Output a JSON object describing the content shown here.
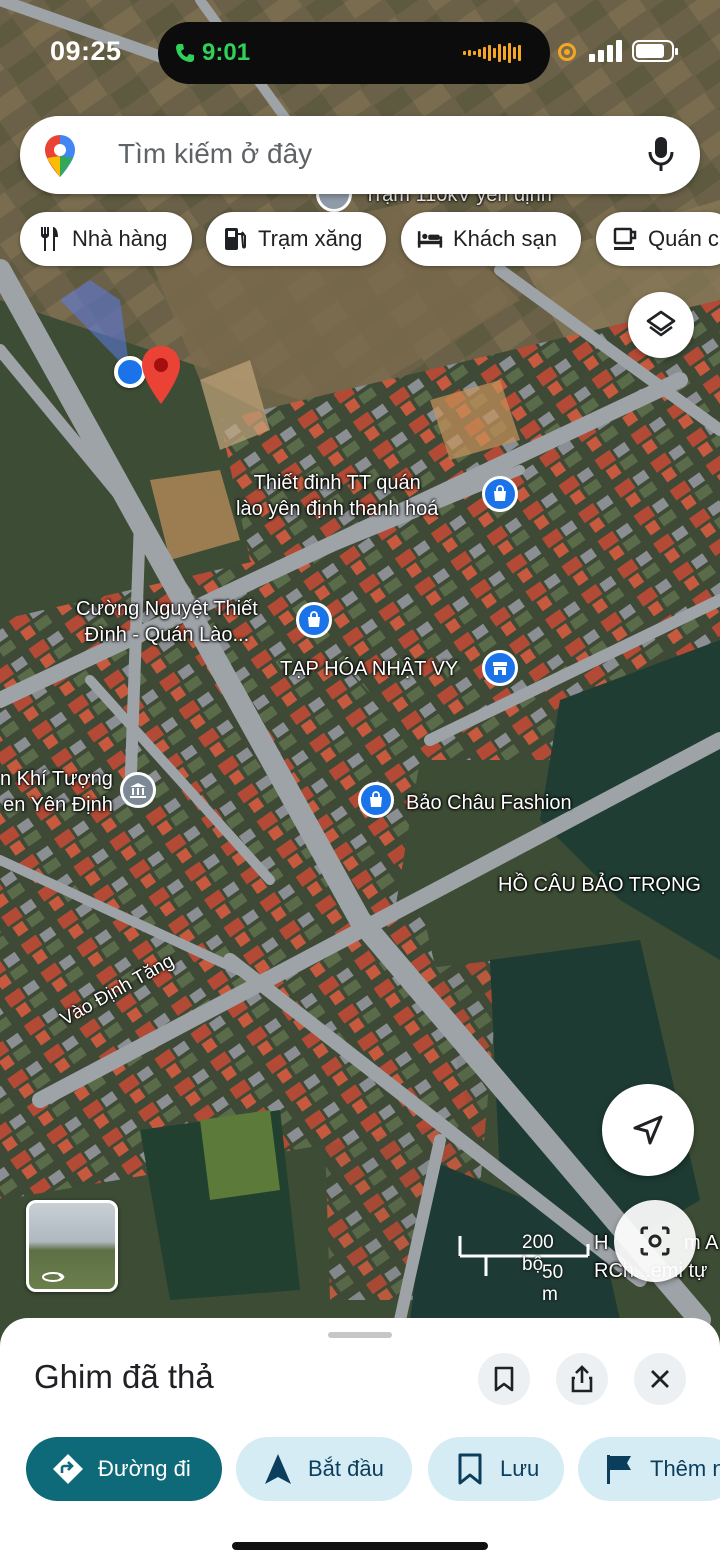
{
  "status_bar": {
    "time": "09:25",
    "call_time": "9:01"
  },
  "search": {
    "placeholder": "Tìm kiếm ở đây"
  },
  "chips": [
    {
      "label": "Nhà hàng",
      "icon": "fork-knife-icon"
    },
    {
      "label": "Trạm xăng",
      "icon": "gas-pump-icon"
    },
    {
      "label": "Khách sạn",
      "icon": "bed-icon"
    },
    {
      "label": "Quán c",
      "icon": "coffee-cup-icon"
    }
  ],
  "map_labels": {
    "top_partial": "Trạm 110kV yên định",
    "thiet_dinh_line1": "Thiết đinh TT quán",
    "thiet_dinh_line2": "lào yên định thanh hoá",
    "cuong_line1": "Cường Nguyệt Thiết",
    "cuong_line2": "Đình - Quán Lào...",
    "tap_hoa": "TẠP HÓA NHẬT VY",
    "khi_tuong_line1": "n Khí Tượng",
    "khi_tuong_line2": "en Yên Định",
    "bao_chau": "Bảo Châu Fashion",
    "ho_cau": "HỒ CÂU BẢO TRỌNG",
    "road": "Vào Định Tăng",
    "bottom_right_1": "H",
    "bottom_right_2": "m A",
    "bottom_right_3": "RCh...emi tự"
  },
  "scale": {
    "feet": "200 bộ",
    "meters": "50 m"
  },
  "sheet": {
    "title": "Ghim đã thả",
    "actions": [
      {
        "label": "Đường đi",
        "icon": "directions-icon"
      },
      {
        "label": "Bắt đầu",
        "icon": "navigation-arrow-icon"
      },
      {
        "label": "Lưu",
        "icon": "bookmark-icon"
      },
      {
        "label": "Thêm n",
        "icon": "flag-icon"
      }
    ]
  },
  "colors": {
    "primary_button": "#0e6a78",
    "secondary_button": "#d6ecf5",
    "pin_red": "#ea4335",
    "location_blue": "#1a73e8"
  }
}
